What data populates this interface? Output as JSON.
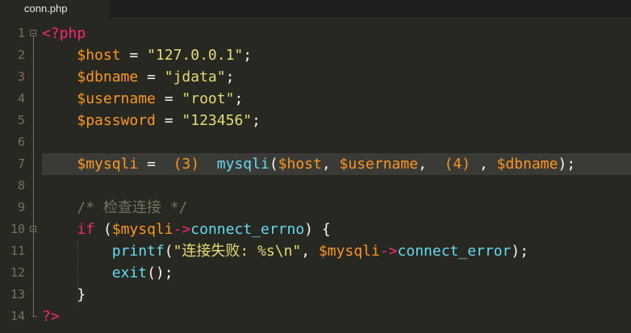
{
  "tab": {
    "label": "conn.php"
  },
  "editor": {
    "line_numbers": [
      "1",
      "2",
      "3",
      "4",
      "5",
      "6",
      "7",
      "8",
      "9",
      "10",
      "11",
      "12",
      "13",
      "14"
    ],
    "lines": [
      [
        {
          "t": "<?php",
          "c": "kw"
        }
      ],
      [
        {
          "t": "    "
        },
        {
          "t": "$host",
          "c": "var"
        },
        {
          "t": " = "
        },
        {
          "t": "\"127.0.0.1\"",
          "c": "str"
        },
        {
          "t": ";"
        }
      ],
      [
        {
          "t": "    "
        },
        {
          "t": "$dbname",
          "c": "var"
        },
        {
          "t": " = "
        },
        {
          "t": "\"jdata\"",
          "c": "str"
        },
        {
          "t": ";"
        }
      ],
      [
        {
          "t": "    "
        },
        {
          "t": "$username",
          "c": "var"
        },
        {
          "t": " = "
        },
        {
          "t": "\"root\"",
          "c": "str"
        },
        {
          "t": ";"
        }
      ],
      [
        {
          "t": "    "
        },
        {
          "t": "$password",
          "c": "var"
        },
        {
          "t": " = "
        },
        {
          "t": "\"123456\"",
          "c": "str"
        },
        {
          "t": ";"
        }
      ],
      [],
      [
        {
          "t": "    "
        },
        {
          "t": "$mysqli",
          "c": "var"
        },
        {
          "t": " =  "
        },
        {
          "t": "(3)",
          "c": "blank"
        },
        {
          "t": "  "
        },
        {
          "t": "mysqli",
          "c": "fn"
        },
        {
          "t": "("
        },
        {
          "t": "$host",
          "c": "var"
        },
        {
          "t": ", "
        },
        {
          "t": "$username",
          "c": "var"
        },
        {
          "t": ",  "
        },
        {
          "t": "(4)",
          "c": "blank"
        },
        {
          "t": " , "
        },
        {
          "t": "$dbname",
          "c": "var"
        },
        {
          "t": ");"
        }
      ],
      [],
      [
        {
          "t": "    "
        },
        {
          "t": "/* 检查连接 */",
          "c": "cm"
        }
      ],
      [
        {
          "t": "    "
        },
        {
          "t": "if",
          "c": "kw"
        },
        {
          "t": " ("
        },
        {
          "t": "$mysqli",
          "c": "var"
        },
        {
          "t": "->",
          "c": "op"
        },
        {
          "t": "connect_errno",
          "c": "fn"
        },
        {
          "t": ") {"
        }
      ],
      [
        {
          "t": "        "
        },
        {
          "t": "printf",
          "c": "fn"
        },
        {
          "t": "("
        },
        {
          "t": "\"连接失败: %s\\n\"",
          "c": "str"
        },
        {
          "t": ", "
        },
        {
          "t": "$mysqli",
          "c": "var"
        },
        {
          "t": "->",
          "c": "op"
        },
        {
          "t": "connect_error",
          "c": "fn"
        },
        {
          "t": ");"
        }
      ],
      [
        {
          "t": "        "
        },
        {
          "t": "exit",
          "c": "fn"
        },
        {
          "t": "();"
        }
      ],
      [
        {
          "t": "    }"
        }
      ],
      [
        {
          "t": "?>",
          "c": "kw"
        }
      ]
    ]
  },
  "colors": {
    "background": "#272822",
    "tabbar": "#1e1f1c",
    "keyword": "#f92672",
    "variable": "#fd971f",
    "string": "#e6db74",
    "function": "#66d9ef",
    "comment": "#75715e"
  }
}
